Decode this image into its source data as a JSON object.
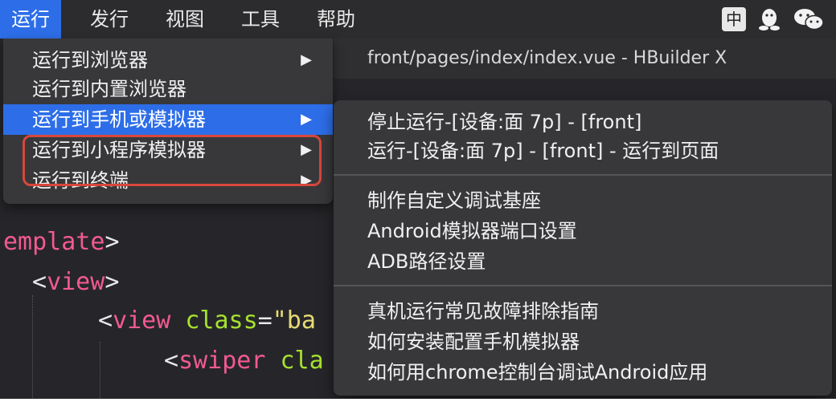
{
  "menubar": {
    "items": [
      "运行",
      "发行",
      "视图",
      "工具",
      "帮助"
    ],
    "ime": "中"
  },
  "window_title": "front/pages/index/index.vue - HBuilder X",
  "run_menu": {
    "items": [
      {
        "label": "运行到浏览器",
        "has_submenu": true
      },
      {
        "label": "运行到内置浏览器",
        "has_submenu": false
      },
      {
        "label": "运行到手机或模拟器",
        "has_submenu": true
      },
      {
        "label": "运行到小程序模拟器",
        "has_submenu": true
      },
      {
        "label": "运行到终端",
        "has_submenu": true
      }
    ],
    "arrow": "▶"
  },
  "submenu": {
    "groups": [
      [
        "停止运行-[设备:面 7p] - [front]",
        "运行-[设备:面 7p] - [front] - 运行到页面"
      ],
      [
        "制作自定义调试基座",
        "Android模拟器端口设置",
        "ADB路径设置"
      ],
      [
        "真机运行常见故障排除指南",
        "如何安装配置手机模拟器",
        "如何用chrome控制台调试Android应用"
      ]
    ]
  },
  "code": {
    "line1_tag": "emplate",
    "line2_tag": "view",
    "line3_tag": "view",
    "line3_attr": "class",
    "line3_str": "\"ba",
    "line4_tag": "swiper",
    "line4_attr": "cla"
  },
  "colors": {
    "accent": "#2d6ee8",
    "highlight_border": "#d8473b",
    "menu_bg": "#38383b"
  }
}
